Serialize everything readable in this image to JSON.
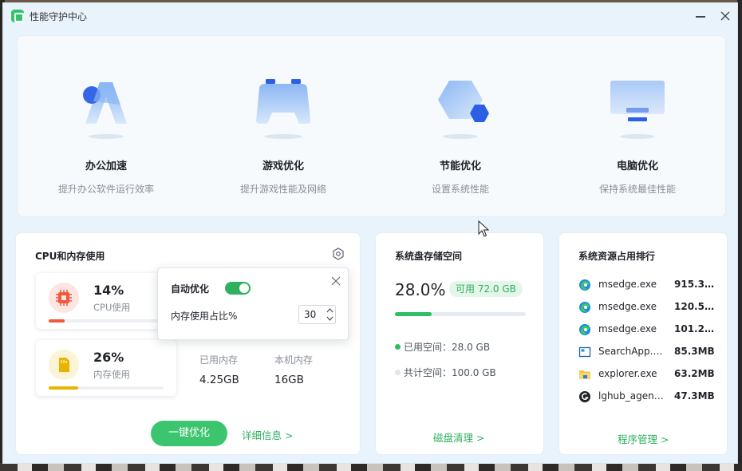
{
  "app": {
    "title": "性能守护中心"
  },
  "features": [
    {
      "name": "办公加速",
      "desc": "提升办公软件运行效率",
      "icon": "office-speedup-icon"
    },
    {
      "name": "游戏优化",
      "desc": "提升游戏性能及网络",
      "icon": "game-controller-icon"
    },
    {
      "name": "节能优化",
      "desc": "设置系统性能",
      "icon": "energy-hexagon-icon"
    },
    {
      "name": "电脑优化",
      "desc": "保持系统最佳性能",
      "icon": "monitor-icon"
    }
  ],
  "cpu_mem": {
    "title": "CPU和内存使用",
    "cpu": {
      "percent": "14%",
      "label": "CPU使用",
      "fill": 0.14
    },
    "mem": {
      "percent": "26%",
      "label": "内存使用",
      "fill": 0.26
    },
    "used_label": "已用内存",
    "used_value": "4.25GB",
    "total_label": "本机内存",
    "total_value": "16GB",
    "optimize_button": "一键优化",
    "detail_link": "详细信息 >"
  },
  "popover": {
    "title": "自动优化",
    "toggle_on": true,
    "ratio_label": "内存使用占比%",
    "ratio_value": "30"
  },
  "disk": {
    "title": "系统盘存储空间",
    "percent": "28.0%",
    "available": "可用 72.0 GB",
    "fill": 0.28,
    "used": "已用空间：28.0 GB",
    "total": "共计空间：100.0 GB",
    "link": "磁盘清理 >"
  },
  "ranking": {
    "title": "系统资源占用排行",
    "rows": [
      {
        "name": "msedge.exe",
        "value": "915.3…",
        "icon": "edge-icon"
      },
      {
        "name": "msedge.exe",
        "value": "120.5…",
        "icon": "edge-icon"
      },
      {
        "name": "msedge.exe",
        "value": "101.2…",
        "icon": "edge-icon"
      },
      {
        "name": "SearchApp.e…",
        "value": "85.3MB",
        "icon": "searchapp-icon"
      },
      {
        "name": "explorer.exe",
        "value": "63.2MB",
        "icon": "folder-icon"
      },
      {
        "name": "lghub_agent…",
        "value": "47.3MB",
        "icon": "lghub-icon"
      }
    ],
    "link": "程序管理 >"
  },
  "colors": {
    "accent": "#2eb05f",
    "cpu": "#f0593f",
    "mem": "#e8b400",
    "window_bg": "#e9f3fb"
  }
}
